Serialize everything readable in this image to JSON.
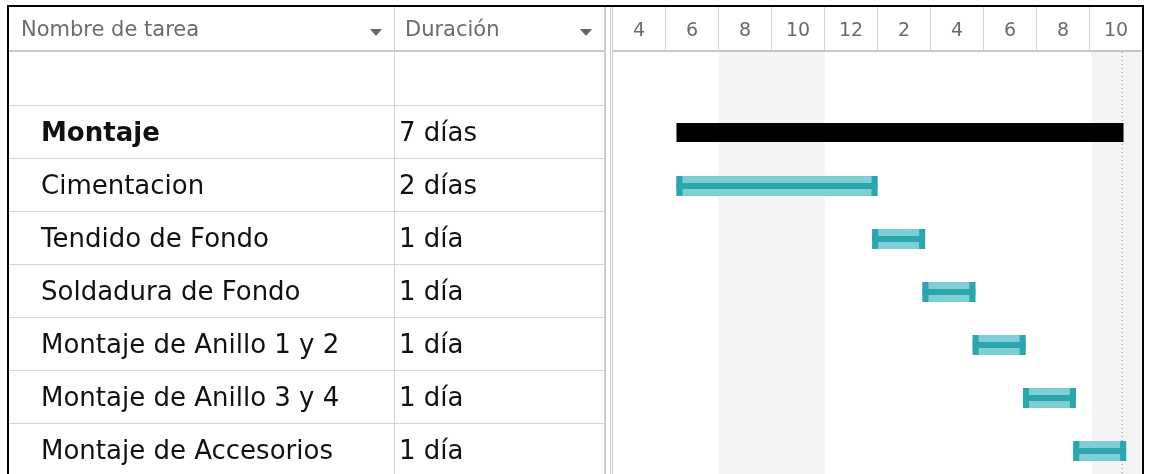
{
  "table": {
    "columns": [
      {
        "label": "Nombre de tarea"
      },
      {
        "label": "Duración"
      }
    ],
    "rows": [
      {
        "name": "Montaje",
        "duration": "7 días",
        "kind": "summary"
      },
      {
        "name": "Cimentacion",
        "duration": "2 días",
        "kind": "task"
      },
      {
        "name": "Tendido de Fondo",
        "duration": "1 día",
        "kind": "task"
      },
      {
        "name": "Soldadura de Fondo",
        "duration": "1 día",
        "kind": "task"
      },
      {
        "name": "Montaje de Anillo 1 y 2",
        "duration": "1 día",
        "kind": "task"
      },
      {
        "name": "Montaje de Anillo 3 y 4",
        "duration": "1 día",
        "kind": "task"
      },
      {
        "name": "Montaje de Accesorios",
        "duration": "1 día",
        "kind": "task"
      }
    ]
  },
  "gantt": {
    "timescale": [
      {
        "label": "4"
      },
      {
        "label": "6"
      },
      {
        "label": "8"
      },
      {
        "label": "10"
      },
      {
        "label": "12"
      },
      {
        "label": "2"
      },
      {
        "label": "4"
      },
      {
        "label": "6"
      },
      {
        "label": "8"
      },
      {
        "label": "10"
      }
    ]
  }
}
